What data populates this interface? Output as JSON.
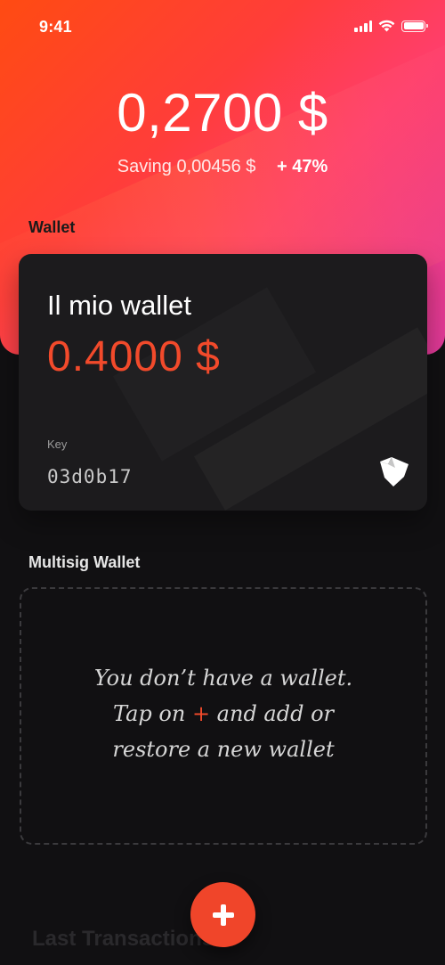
{
  "status_bar": {
    "time": "9:41"
  },
  "header": {
    "balance": "0,2700 $",
    "saving_label": "Saving 0,00456 $",
    "change": "+ 47%"
  },
  "wallet_section": {
    "title": "Wallet",
    "card": {
      "name": "Il mio wallet",
      "amount": "0.4000 $",
      "key_label": "Key",
      "key_value": "03d0b17",
      "logo_icon": "fox-shield-icon"
    }
  },
  "multisig_section": {
    "title": "Multisig Wallet",
    "empty_line1": "You don’t have a wallet.",
    "empty_line2_pre": "Tap on ",
    "empty_line2_plus": "+",
    "empty_line2_post": " and add or",
    "empty_line3": "restore a new wallet"
  },
  "transactions_section": {
    "title": "Last Transactions"
  },
  "fab": {
    "icon": "plus-icon"
  },
  "colors": {
    "accent": "#f24a2b",
    "background": "#111012",
    "card": "#1c1b1d"
  }
}
